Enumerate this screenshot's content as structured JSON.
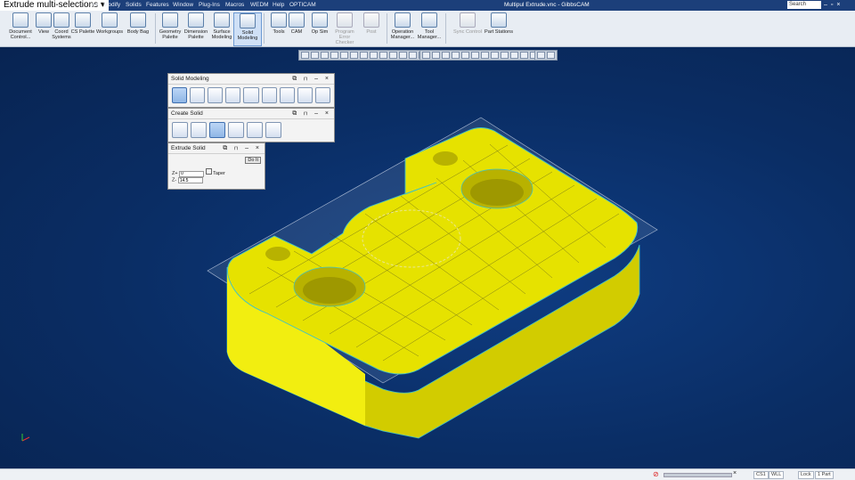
{
  "window": {
    "title_tag": "Extrude multi-selections",
    "doc_title": "Multipul Extrude.vnc - GibbsCAM",
    "search_label": "Search",
    "controls": "–▫×"
  },
  "menu": [
    "ne",
    "Modify",
    "Solids",
    "Features",
    "Window",
    "Plug-Ins",
    "Macros",
    "WEDM",
    "Help",
    "OPTICAM"
  ],
  "ribbon": [
    {
      "label": "Document\nControl..."
    },
    {
      "label": "View"
    },
    {
      "label": "Coord\nSystems"
    },
    {
      "label": "CS Palette"
    },
    {
      "label": "Workgroups"
    },
    {
      "label": "Body Bag"
    },
    {
      "label": "Geometry\nPalette"
    },
    {
      "label": "Dimension\nPalette"
    },
    {
      "label": "Surface\nModeling"
    },
    {
      "label": "Solid\nModeling",
      "active": true
    },
    {
      "label": "Tools"
    },
    {
      "label": "CAM"
    },
    {
      "label": "Op Sim"
    },
    {
      "label": "Program\nError Checker",
      "dim": true
    },
    {
      "label": "Post",
      "dim": true
    },
    {
      "label": "Operation\nManager..."
    },
    {
      "label": "Tool\nManager..."
    },
    {
      "label": "Sync Control",
      "dim": true
    },
    {
      "label": "Part Stations"
    }
  ],
  "palettes": {
    "solid_modeling": {
      "title": "Solid Modeling",
      "controls": "⧉ ⊓ – ×"
    },
    "create_solid": {
      "title": "Create Solid",
      "controls": "⧉ ⊓ – ×"
    },
    "extrude_solid": {
      "title": "Extrude Solid",
      "controls": "⧉ ⊓ – ×",
      "do_it": "Do It",
      "z_plus_label": "Z+",
      "z_plus_value": "0",
      "z_minus_label": "Z-",
      "z_minus_value": "14.5",
      "taper_label": "Taper"
    }
  },
  "status": {
    "cs": "CS1",
    "mode": "WLL",
    "lock": "Lock",
    "parts": "1 Part"
  },
  "colors": {
    "part": "#e6e200",
    "part_shade": "#c9c300",
    "edge": "#3fc3c9",
    "background": "#0b2b5e"
  }
}
